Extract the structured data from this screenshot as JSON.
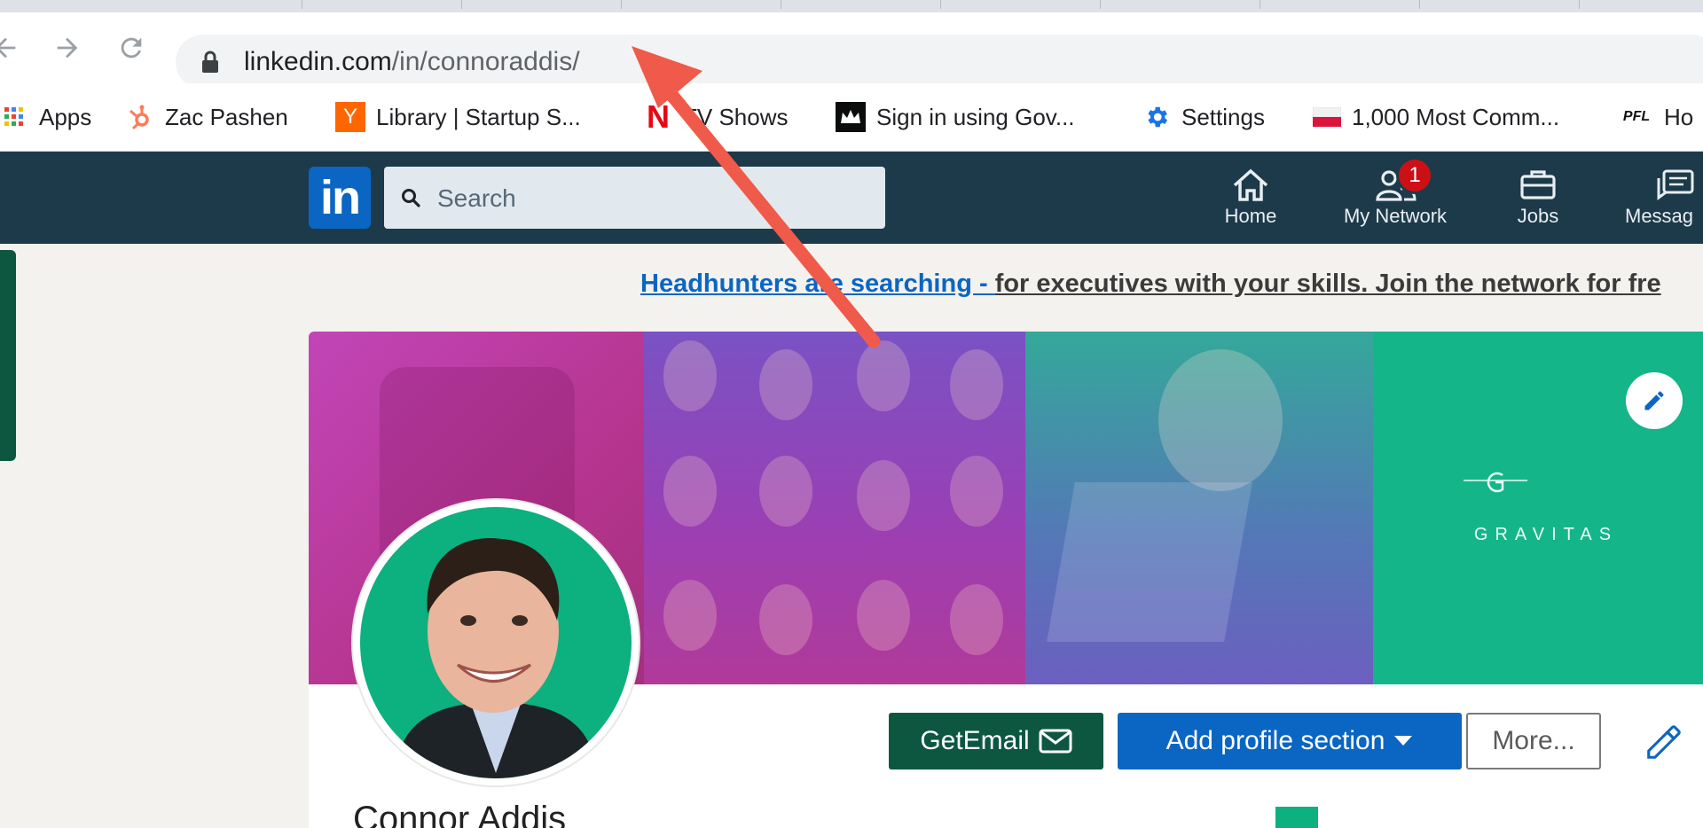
{
  "browser": {
    "url_domain": "linkedin.com",
    "url_path": "/in/connoraddis/",
    "bookmarks": [
      {
        "label": "Apps",
        "icon": "apps-grid-icon"
      },
      {
        "label": "Zac Pashen",
        "icon": "hubspot-icon"
      },
      {
        "label": "Library | Startup S...",
        "icon": "ycombinator-icon",
        "icon_text": "Y"
      },
      {
        "label": "TV Shows",
        "icon": "netflix-icon",
        "icon_text": "N"
      },
      {
        "label": "Sign in using Gov...",
        "icon": "crown-icon"
      },
      {
        "label": "Settings",
        "icon": "gear-icon"
      },
      {
        "label": "1,000 Most Comm...",
        "icon": "poland-flag-icon"
      },
      {
        "label": "Ho",
        "icon": "pfl-icon",
        "icon_text": "PFL"
      }
    ]
  },
  "linkedin": {
    "logo_text": "in",
    "search_placeholder": "Search",
    "nav": [
      {
        "label": "Home",
        "icon": "home-icon"
      },
      {
        "label": "My Network",
        "icon": "network-icon",
        "badge": "1"
      },
      {
        "label": "Jobs",
        "icon": "briefcase-icon"
      },
      {
        "label": "Messag",
        "icon": "messaging-icon"
      }
    ],
    "colors": {
      "nav_bg": "#1d3a4a",
      "brand_blue": "#0a66c2",
      "badge_red": "#cc1016",
      "getemail_green": "#0d5741"
    }
  },
  "promo": {
    "link_text": "Headhunters are searching - ",
    "rest_text": "for executives with your skills. Join the network for fre"
  },
  "profile": {
    "banner_brand": "GRAVITAS",
    "buttons": {
      "getemail": "GetEmail",
      "add_section": "Add profile section",
      "more": "More..."
    },
    "name_fragment": "Connor Addis"
  }
}
